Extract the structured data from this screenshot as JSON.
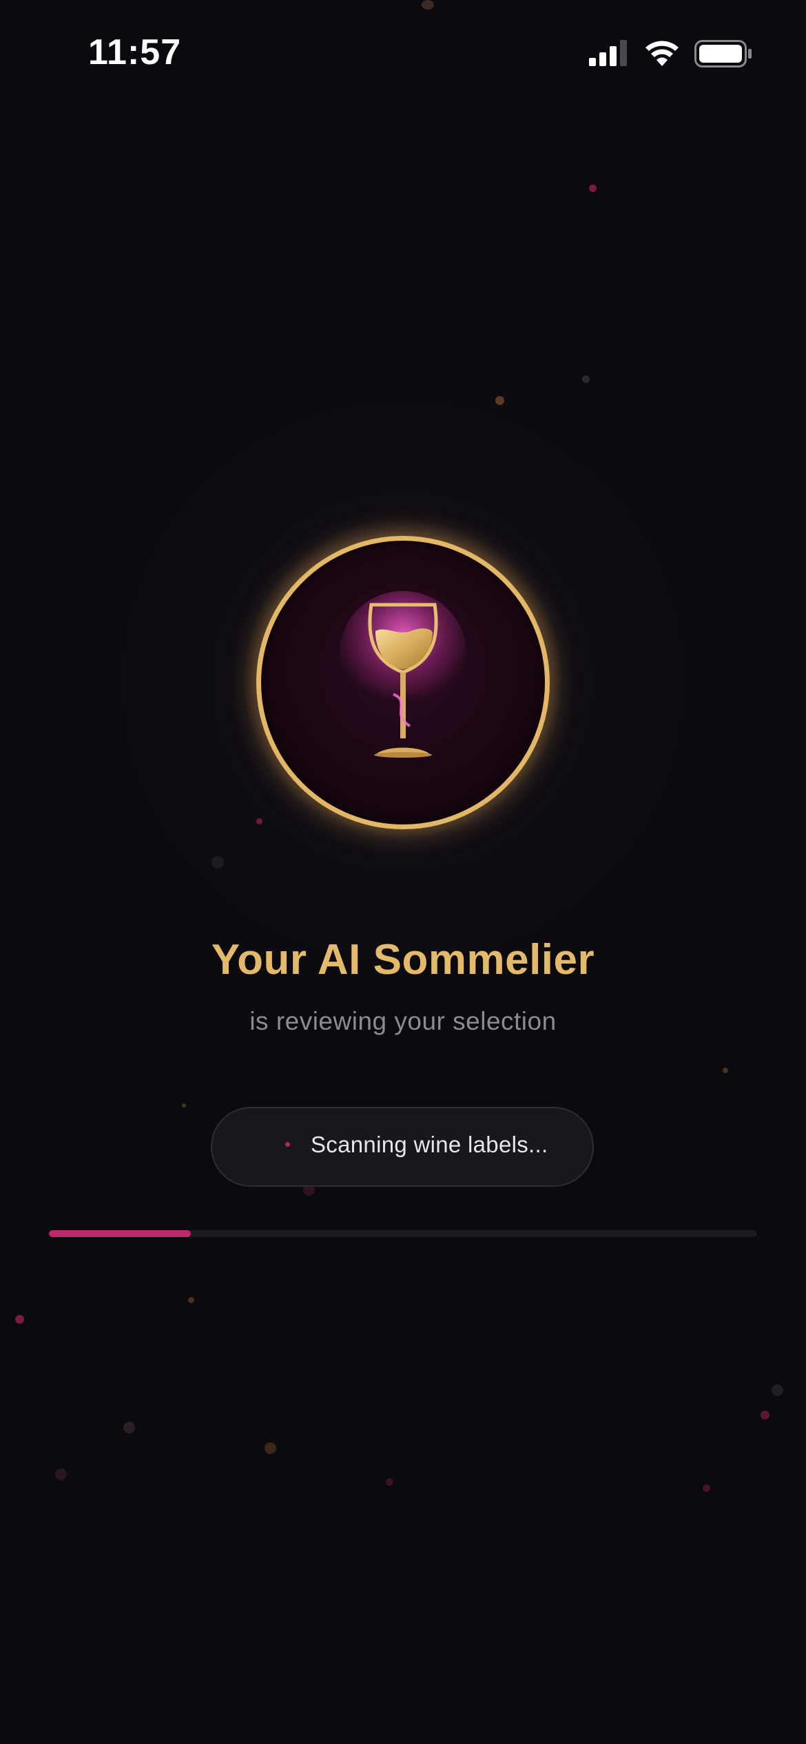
{
  "status_bar": {
    "time": "11:57",
    "signal_icon": "cellular-signal-icon",
    "wifi_icon": "wifi-icon",
    "battery_icon": "battery-icon"
  },
  "logo": {
    "icon": "wine-glass-icon",
    "ring_color": "#e2b765",
    "glow_color": "#e066c8"
  },
  "title": "Your AI Sommelier",
  "subtitle": "is reviewing your selection",
  "status_pill": {
    "text": "Scanning wine labels..."
  },
  "progress": {
    "value": 0.2
  },
  "colors": {
    "background": "#0b0a0e",
    "accent": "#c5256a",
    "gold": "#e3b96a"
  }
}
